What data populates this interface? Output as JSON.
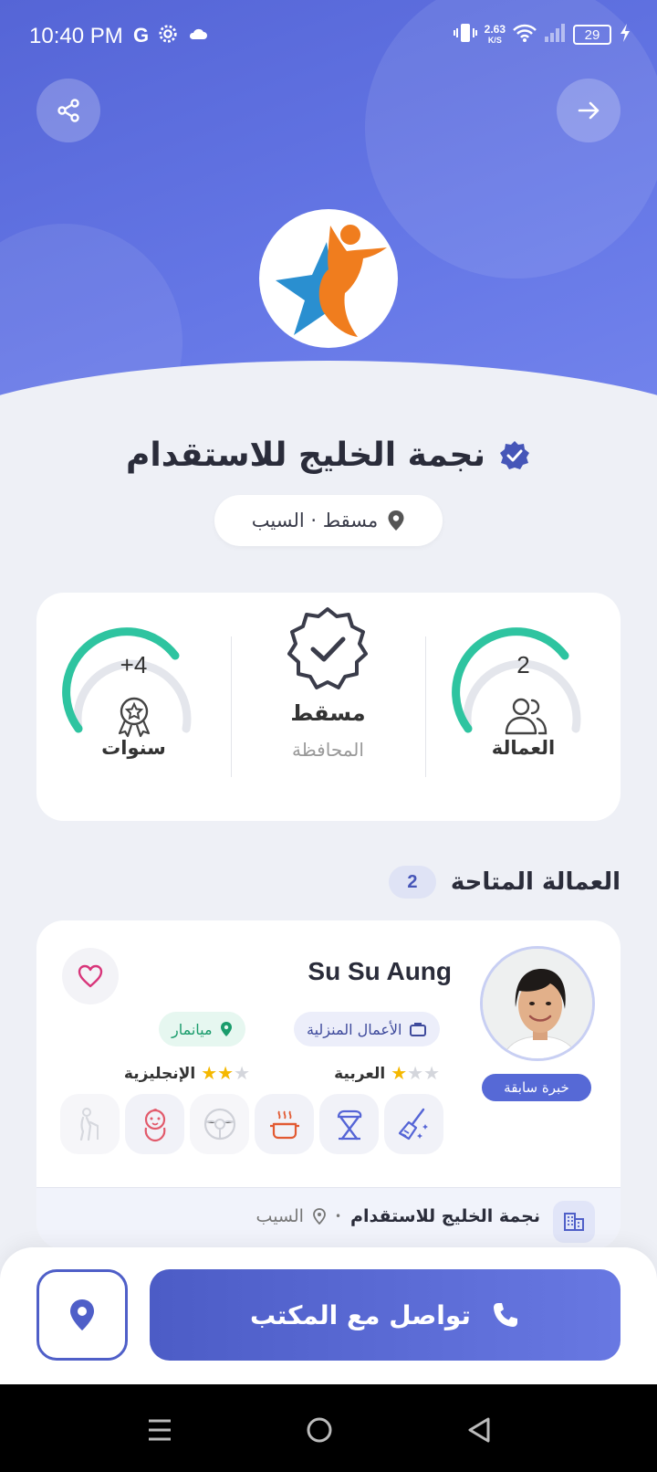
{
  "status_bar": {
    "time": "10:40 PM",
    "g_label": "G",
    "speed_value": "2.63",
    "speed_unit": "K/S",
    "battery": "29"
  },
  "header": {
    "share_icon": "share-icon",
    "back_icon": "arrow-right-icon"
  },
  "office": {
    "name": "نجمة الخليج للاستقدام",
    "verified": true,
    "location": "مسقط · السيب"
  },
  "stats": {
    "years_value": "+4",
    "years_label": "سنوات",
    "governorate_value": "مسقط",
    "governorate_label": "المحافظة",
    "workers_value": "2",
    "workers_label": "العمالة"
  },
  "section": {
    "title": "العمالة المتاحة",
    "count": "2"
  },
  "worker": {
    "name": "Su Su Aung",
    "experience_badge": "خبرة سابقة",
    "job": "الأعمال المنزلية",
    "country": "ميانمار",
    "languages": [
      {
        "name": "العربية",
        "rating": 1,
        "max": 3
      },
      {
        "name": "الإنجليزية",
        "rating": 2,
        "max": 3
      }
    ],
    "skills": [
      {
        "icon": "cleaning-icon",
        "active": true
      },
      {
        "icon": "ironing-icon",
        "active": true
      },
      {
        "icon": "cooking-icon",
        "active": true
      },
      {
        "icon": "driving-icon",
        "active": false
      },
      {
        "icon": "babysitting-icon",
        "active": true
      },
      {
        "icon": "elderly-care-icon",
        "active": false
      }
    ],
    "footer_office": "نجمة الخليج للاستقدام",
    "footer_separator": "•",
    "footer_city": "السيب"
  },
  "actions": {
    "contact_label": "تواصل مع المكتب"
  },
  "colors": {
    "primary": "#5565d6",
    "accent_teal": "#2ec4a0",
    "star": "#f5b800",
    "logo_orange": "#f07d1e",
    "logo_blue": "#2a8fd0"
  }
}
